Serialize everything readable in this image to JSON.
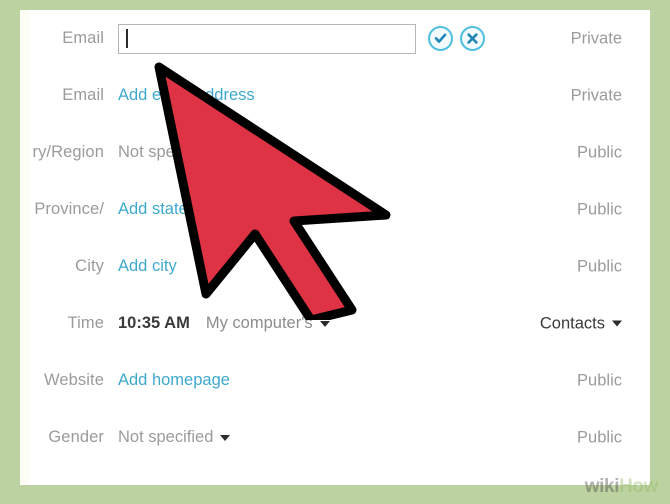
{
  "theme": {
    "frame_color": "#bdd2a1",
    "panel_color": "#ffffff",
    "link_color": "#3fa8cd",
    "label_color": "#9b9b9b",
    "accent_icon_color": "#4fbfe0",
    "cursor_color": "#dd3344"
  },
  "form": {
    "rows": [
      {
        "label": "Email",
        "type": "input",
        "value": "",
        "placeholder": "",
        "privacy": "Private",
        "privacy_style": "muted",
        "has_edit_icons": true,
        "accept_icon": "check-circle-icon",
        "cancel_icon": "close-circle-icon"
      },
      {
        "label": "Email",
        "type": "link",
        "value": "Add email address",
        "privacy": "Private",
        "privacy_style": "muted",
        "has_edit_icons": false
      },
      {
        "label": "ry/Region",
        "type": "muted",
        "value": "Not specified",
        "privacy": "Public",
        "privacy_style": "muted",
        "has_edit_icons": false
      },
      {
        "label": "/Province",
        "type": "link",
        "value": "Add state/province",
        "privacy": "Public",
        "privacy_style": "muted",
        "has_edit_icons": false
      },
      {
        "label": "City",
        "type": "link",
        "value": "Add city",
        "privacy": "Public",
        "privacy_style": "muted",
        "has_edit_icons": false
      },
      {
        "label": "Time",
        "type": "time",
        "value": "10:35 AM",
        "dropdown_value": "My computer's",
        "privacy": "Contacts",
        "privacy_style": "dark-dropdown",
        "has_edit_icons": false
      },
      {
        "label": "Website",
        "type": "link",
        "value": "Add homepage",
        "privacy": "Public",
        "privacy_style": "muted",
        "has_edit_icons": false
      },
      {
        "label": "Gender",
        "type": "dropdown",
        "value": "Not specified",
        "privacy": "Public",
        "privacy_style": "muted",
        "has_edit_icons": false
      }
    ]
  },
  "watermark": {
    "part1": "wiki",
    "part2": "How"
  }
}
